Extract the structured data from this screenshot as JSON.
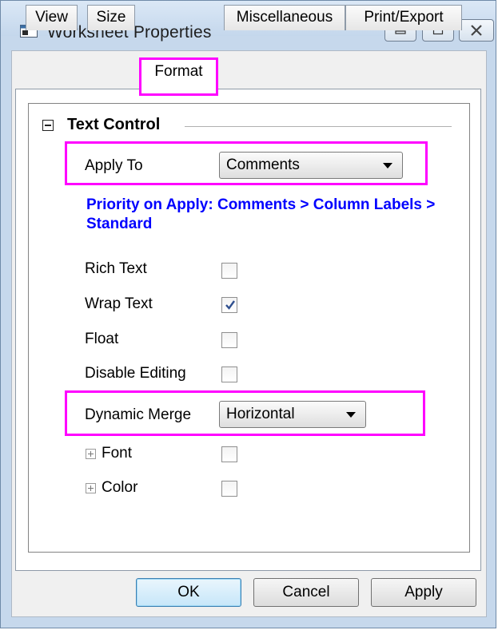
{
  "window": {
    "title": "Worksheet Properties"
  },
  "tabs": [
    {
      "label": "View"
    },
    {
      "label": "Size"
    },
    {
      "label": "Format"
    },
    {
      "label": "Miscellaneous"
    },
    {
      "label": "Print/Export"
    }
  ],
  "active_tab": "Format",
  "group": {
    "title": "Text Control"
  },
  "apply_to": {
    "label": "Apply To",
    "value": "Comments"
  },
  "note": "Priority on Apply: Comments > Column Labels > Standard",
  "options": [
    {
      "label": "Rich Text",
      "checked": false
    },
    {
      "label": "Wrap Text",
      "checked": true
    },
    {
      "label": "Float",
      "checked": false
    },
    {
      "label": "Disable Editing",
      "checked": false
    }
  ],
  "dynamic_merge": {
    "label": "Dynamic Merge",
    "value": "Horizontal"
  },
  "subgroups": [
    {
      "label": "Font",
      "checked": false
    },
    {
      "label": "Color",
      "checked": false
    }
  ],
  "buttons": {
    "ok": "OK",
    "cancel": "Cancel",
    "apply": "Apply"
  },
  "colors": {
    "highlight": "#ff00ff",
    "note": "#0000ff",
    "window_frame": "#c6d8ec"
  }
}
